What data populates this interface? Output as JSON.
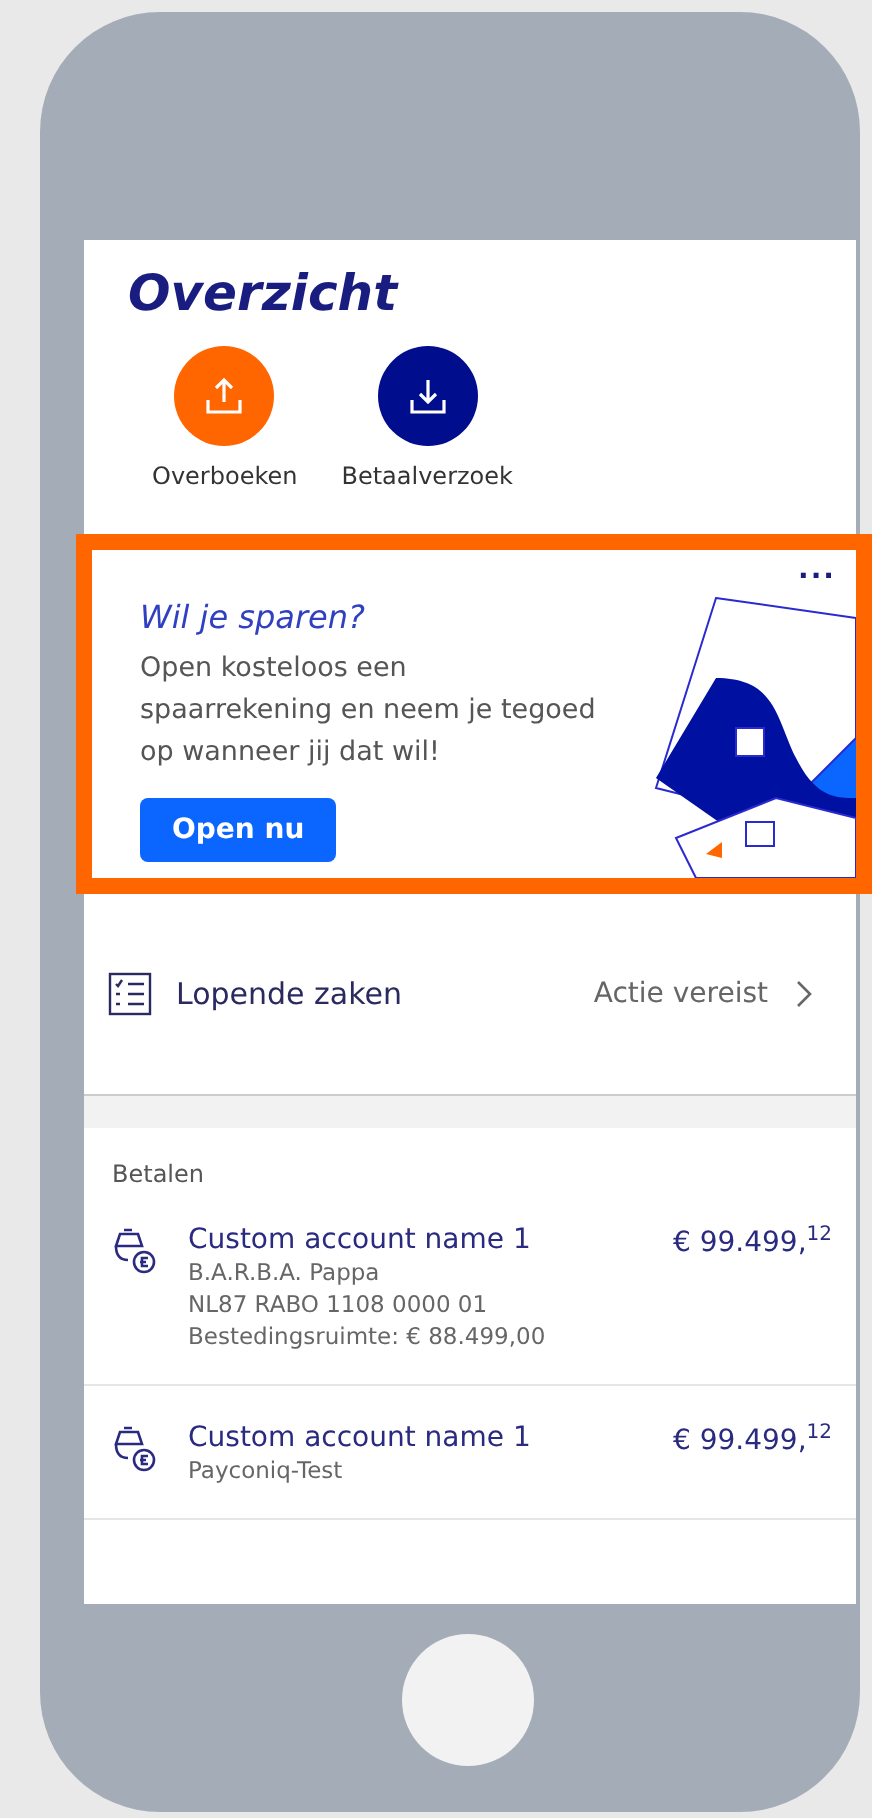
{
  "header": {
    "title": "Overzicht"
  },
  "quick_actions": [
    {
      "label": "Overboeken",
      "kind": "upload",
      "color": "#ff6600"
    },
    {
      "label": "Betaalverzoek",
      "kind": "download",
      "color": "#000d8c"
    }
  ],
  "promo": {
    "title": "Wil je sparen?",
    "body": "Open kosteloos een spaarrekening en neem je tegoed op wanneer jij dat wil!",
    "button": "Open nu",
    "menu": "..."
  },
  "tasks": {
    "label": "Lopende zaken",
    "status": "Actie vereist"
  },
  "accounts_section": {
    "title": "Betalen",
    "accounts": [
      {
        "name": "Custom account name 1",
        "amount": "€ 99.499,",
        "cents": "12",
        "details": [
          "B.A.R.B.A. Pappa",
          "NL87 RABO 1108 0000 01",
          "Bestedingsruimte: € 88.499,00"
        ]
      },
      {
        "name": "Custom account name 1",
        "amount": "€ 99.499,",
        "cents": "12",
        "details": [
          "Payconiq-Test"
        ]
      }
    ]
  }
}
